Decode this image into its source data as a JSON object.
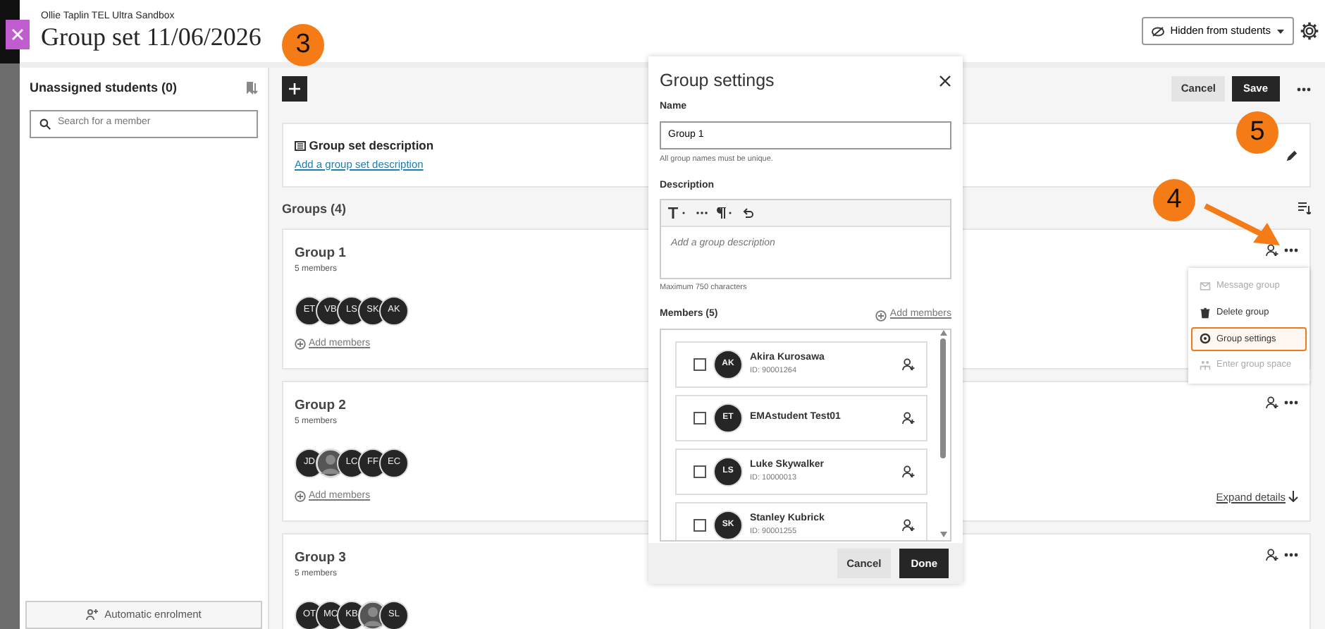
{
  "header": {
    "course": "Ollie Taplin TEL Ultra Sandbox",
    "title": "Group set 11/06/2026",
    "callout": "3",
    "visibility": "Hidden from students"
  },
  "sidebar": {
    "title": "Unassigned students (0)",
    "search_placeholder": "Search for a member",
    "auto_button": "Automatic enrolment"
  },
  "toolbar": {
    "cancel": "Cancel",
    "save": "Save",
    "callout": "5"
  },
  "description_card": {
    "title": "Group set description",
    "link": "Add a group set description"
  },
  "groups_heading": "Groups (4)",
  "groups": [
    {
      "name": "Group 1",
      "count": "5 members",
      "members": [
        {
          "kind": "initials",
          "initials": "ET"
        },
        {
          "kind": "initials",
          "initials": "VB"
        },
        {
          "kind": "initials",
          "initials": "LS"
        },
        {
          "kind": "initials",
          "initials": "SK"
        },
        {
          "kind": "initials",
          "initials": "AK"
        }
      ],
      "add_label": "Add members",
      "callout": "4"
    },
    {
      "name": "Group 2",
      "count": "5 members",
      "members": [
        {
          "kind": "initials",
          "initials": "JD"
        },
        {
          "kind": "photo"
        },
        {
          "kind": "initials",
          "initials": "LC"
        },
        {
          "kind": "initials",
          "initials": "FF"
        },
        {
          "kind": "initials",
          "initials": "EC"
        }
      ],
      "add_label": "Add members",
      "expand": "Expand details"
    },
    {
      "name": "Group 3",
      "count": "5 members",
      "members": [
        {
          "kind": "initials",
          "initials": "OT"
        },
        {
          "kind": "initials",
          "initials": "MC"
        },
        {
          "kind": "initials",
          "initials": "KB"
        },
        {
          "kind": "photo"
        },
        {
          "kind": "initials",
          "initials": "SL"
        }
      ]
    }
  ],
  "menu": [
    {
      "kind": "message",
      "label": "Message group",
      "disabled": true,
      "selected": false
    },
    {
      "kind": "delete",
      "label": "Delete group",
      "disabled": false,
      "selected": false
    },
    {
      "kind": "settings",
      "label": "Group settings",
      "disabled": false,
      "selected": true
    },
    {
      "kind": "space",
      "label": "Enter group space",
      "disabled": true,
      "selected": false
    }
  ],
  "dialog": {
    "title": "Group settings",
    "name_label": "Name",
    "name_value": "Group 1",
    "name_hint": "All group names must be unique.",
    "description_label": "Description",
    "description_placeholder": "Add a group description",
    "description_hint": "Maximum 750 characters",
    "members_label": "Members (5)",
    "add_members": "Add members",
    "members": [
      {
        "initials": "AK",
        "name": "Akira Kurosawa",
        "id": "ID: 90001264",
        "checked": false
      },
      {
        "initials": "ET",
        "name": "EMAstudent Test01",
        "checked": false
      },
      {
        "initials": "LS",
        "name": "Luke Skywalker",
        "id": "ID: 10000013",
        "checked": false
      },
      {
        "initials": "SK",
        "name": "Stanley Kubrick",
        "id": "ID: 90001255",
        "checked": false
      }
    ],
    "cancel": "Cancel",
    "done": "Done"
  }
}
